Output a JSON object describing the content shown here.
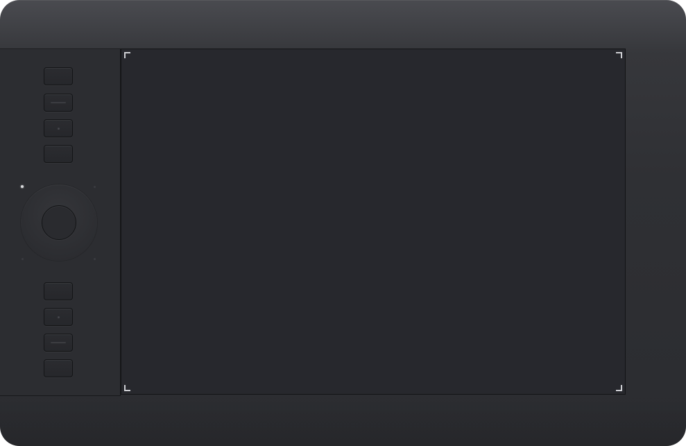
{
  "device": {
    "name": "",
    "body_color": "#2f3034",
    "active_area_color": "#27282d",
    "corner_marker_color": "#cfd0d4"
  },
  "express_keys": {
    "top": [
      {
        "id": "key-1",
        "mark": "none"
      },
      {
        "id": "key-2",
        "mark": "line"
      },
      {
        "id": "key-3",
        "mark": "dot"
      },
      {
        "id": "key-4",
        "mark": "none"
      }
    ],
    "bottom": [
      {
        "id": "key-5",
        "mark": "none"
      },
      {
        "id": "key-6",
        "mark": "dot"
      },
      {
        "id": "key-7",
        "mark": "line"
      },
      {
        "id": "key-8",
        "mark": "none"
      }
    ]
  },
  "touch_ring": {
    "mode_leds": [
      {
        "position": "top-left",
        "state": "on"
      },
      {
        "position": "top-right",
        "state": "off"
      },
      {
        "position": "bottom-left",
        "state": "off"
      },
      {
        "position": "bottom-right",
        "state": "off"
      }
    ],
    "led_on_color": "#d9dadd"
  },
  "icons": {
    "corner_marker": "corner-bracket-icon",
    "key_line": "line-mark-icon",
    "key_dot": "dot-mark-icon"
  }
}
